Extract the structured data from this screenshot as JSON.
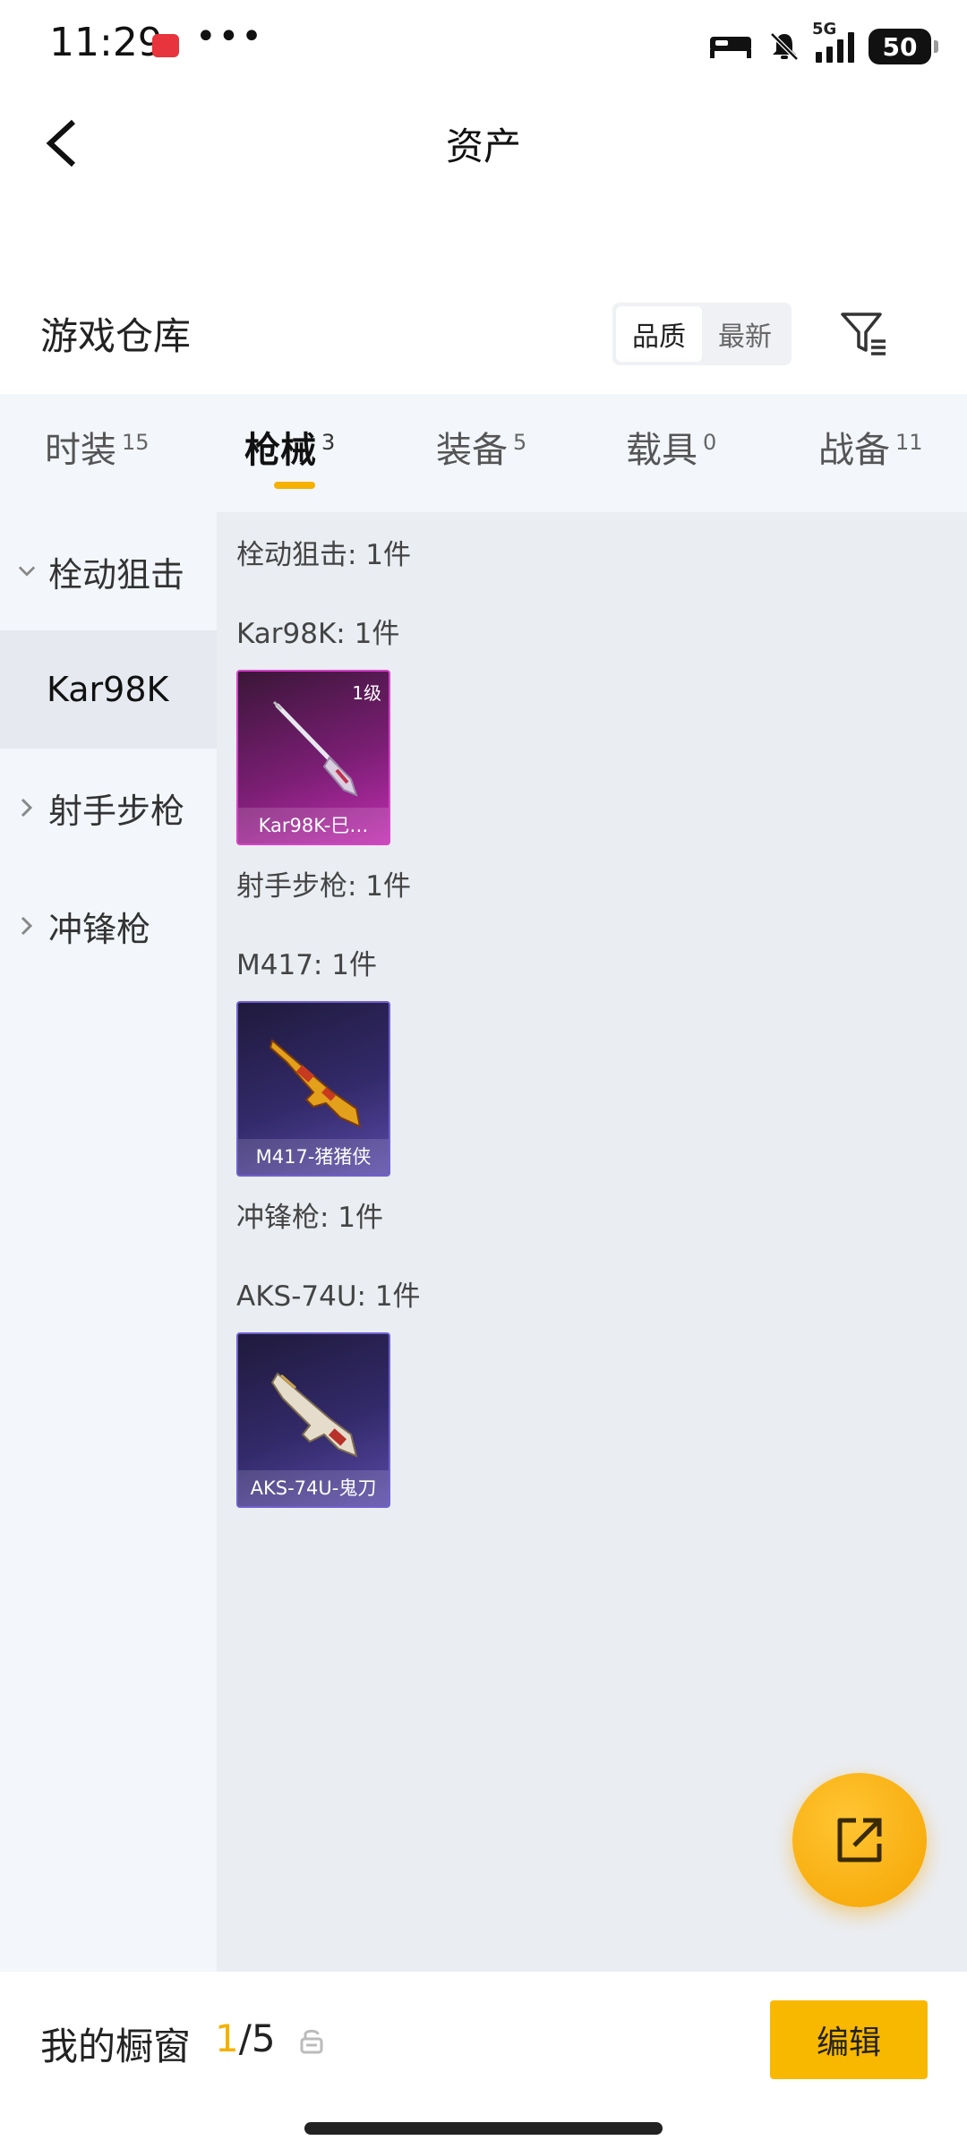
{
  "status_bar": {
    "time": "11:29",
    "dots": "•••",
    "network": "5G",
    "battery": "50"
  },
  "header": {
    "title": "资产"
  },
  "warehouse": {
    "title": "游戏仓库",
    "sort_options": [
      "品质",
      "最新"
    ],
    "sort_selected": "品质"
  },
  "tabs": [
    {
      "label": "时装",
      "count": "15"
    },
    {
      "label": "枪械",
      "count": "3"
    },
    {
      "label": "装备",
      "count": "5"
    },
    {
      "label": "载具",
      "count": "0"
    },
    {
      "label": "战备",
      "count": "11"
    }
  ],
  "active_tab": "枪械",
  "sidebar": {
    "items": [
      {
        "label": "栓动狙击",
        "expanded": true
      },
      {
        "label": "Kar98K",
        "selected": true
      },
      {
        "label": "射手步枪",
        "expanded": false
      },
      {
        "label": "冲锋枪",
        "expanded": false
      }
    ]
  },
  "content": {
    "sections": [
      {
        "category": "栓动狙击: 1件",
        "model": "Kar98K: 1件",
        "item": {
          "name": "Kar98K-巳…",
          "level": "1级",
          "rarity": "purple"
        }
      },
      {
        "category": "射手步枪: 1件",
        "model": "M417: 1件",
        "item": {
          "name": "M417-猪猪侠",
          "level": "",
          "rarity": "blue"
        }
      },
      {
        "category": "冲锋枪: 1件",
        "model": "AKS-74U: 1件",
        "item": {
          "name": "AKS-74U-鬼刀",
          "level": "",
          "rarity": "blue"
        }
      }
    ]
  },
  "bottom_bar": {
    "label": "我的橱窗",
    "current": "1",
    "total": "/5",
    "edit_label": "编辑"
  },
  "colors": {
    "accent": "#f5b100",
    "purple_rarity": "#c02eb0",
    "blue_rarity": "#5a4aa8"
  }
}
